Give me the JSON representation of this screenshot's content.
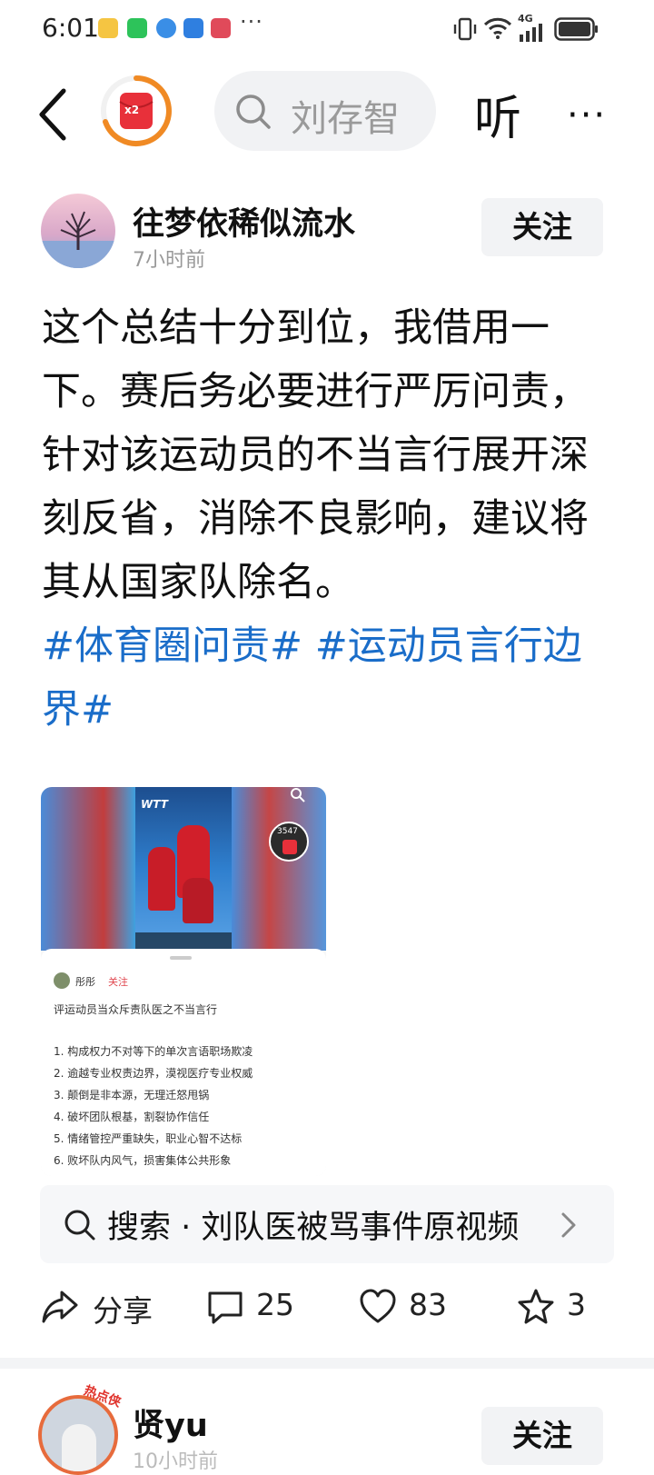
{
  "status_bar": {
    "time": "6:01",
    "overflow": "···",
    "network_label": "4G",
    "app_icons": [
      "weibo-icon",
      "wechat-icon",
      "browser-icon",
      "folder-icon",
      "game-icon"
    ]
  },
  "top_bar": {
    "search_placeholder": "刘存智",
    "listen_label": "听",
    "more_label": "···",
    "red_packet_badge": "x2"
  },
  "post": {
    "author": "往梦依稀似流水",
    "time_ago": "7小时前",
    "follow_label": "关注",
    "text": "这个总结十分到位，我借用一下。赛后务必要进行严厉问责，针对该运动员的不当言行展开深刻反省，消除不良影响，建议将其从国家队除名。",
    "tags": [
      "#体育圈问责#",
      "#运动员言行边界#"
    ],
    "image": {
      "video_brand": "WTT",
      "like_count": "3547",
      "embedded_author": "彤彤",
      "embedded_follow": "关注",
      "embedded_title": "评运动员当众斥责队医之不当言行",
      "embedded_points": [
        "1. 构成权力不对等下的单次言语职场欺凌",
        "2. 逾越专业权责边界，漠视医疗专业权威",
        "3. 颠倒是非本源，无理迁怒甩锅",
        "4. 破坏团队根基，割裂协作信任",
        "5. 情绪管控严重缺失，职业心智不达标",
        "6. 败坏队内风气，损害集体公共形象"
      ]
    },
    "search_suggestion": "搜索 · 刘队医被骂事件原视频",
    "actions": {
      "share_label": "分享",
      "comment_count": "25",
      "like_count": "83",
      "favorite_count": "3"
    }
  },
  "next_post": {
    "author": "贤yu",
    "time_ago": "10小时前",
    "follow_label": "关注",
    "avatar_badge": "热点侠"
  },
  "colors": {
    "tag_blue": "#1a6dc9",
    "red_packet": "#e8303a",
    "ring_orange": "#f08a24"
  }
}
